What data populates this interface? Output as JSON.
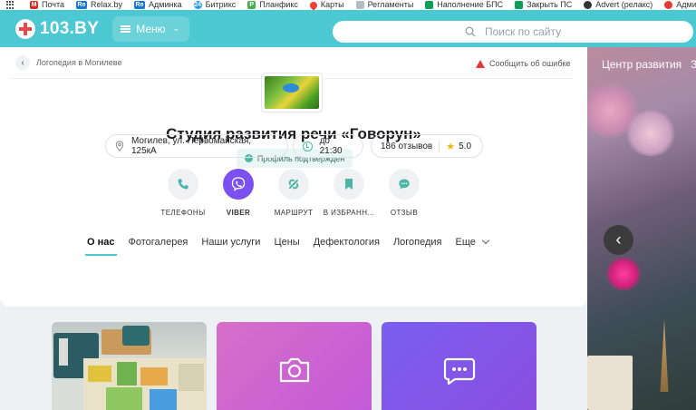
{
  "browser": {
    "bookmarks": [
      {
        "label": "Почта",
        "icon": "gmail-icon",
        "color": "#d93025",
        "glyph": "M"
      },
      {
        "label": "Relax.by",
        "icon": "relax-icon",
        "color": "#1976d2",
        "glyph": "Re"
      },
      {
        "label": "Админка",
        "icon": "relax-admin-icon",
        "color": "#1976d2",
        "glyph": "Re"
      },
      {
        "label": "Битрикс",
        "icon": "bitrix-icon",
        "color": "#2196f3",
        "glyph": "24"
      },
      {
        "label": "Планфикс",
        "icon": "planfix-icon",
        "color": "#4caf50",
        "glyph": "P"
      },
      {
        "label": "Карты",
        "icon": "maps-icon",
        "color": "#ea4335",
        "glyph": "●"
      },
      {
        "label": "Регламенты",
        "icon": "doc-icon",
        "color": "#90a4ae",
        "glyph": "≡"
      },
      {
        "label": "Наполнение БПС",
        "icon": "sheets-icon",
        "color": "#0f9d58",
        "glyph": "▦"
      },
      {
        "label": "Закрыть ПС",
        "icon": "sheets-icon-2",
        "color": "#0f9d58",
        "glyph": "▦"
      },
      {
        "label": "Advert (релакс)",
        "icon": "github-icon",
        "color": "#333333",
        "glyph": "◉"
      },
      {
        "label": "Админ",
        "icon": "admin-icon",
        "color": "#e53935",
        "glyph": "●"
      }
    ]
  },
  "header": {
    "logo": "103.BY",
    "menu_label": "Меню",
    "search_placeholder": "Поиск по сайту",
    "color": "#4bc8d1"
  },
  "breadcrumb": {
    "label": "Логопедия в Могилеве"
  },
  "report": {
    "label": "Сообщить об ошибке"
  },
  "profile": {
    "title": "Студия развития речи «Говорун»",
    "verified": "Профиль подтвержден",
    "address": "Могилев, ул. Первомайская, 125кА",
    "hours": "до 21:30",
    "reviews": "186 отзывов",
    "rating": "5.0"
  },
  "actions": [
    {
      "label": "ТЕЛЕФОНЫ",
      "icon": "phone-icon"
    },
    {
      "label": "VIBER",
      "icon": "viber-icon"
    },
    {
      "label": "МАРШРУТ",
      "icon": "route-icon"
    },
    {
      "label": "В ИЗБРАНН...",
      "icon": "bookmark-icon"
    },
    {
      "label": "ОТЗЫВ",
      "icon": "review-icon"
    }
  ],
  "tabs": [
    "О нас",
    "Фотогалерея",
    "Наши услуги",
    "Цены",
    "Дефектология",
    "Логопедия",
    "Еще"
  ],
  "banner": {
    "items": [
      "Центр развития",
      "За"
    ]
  },
  "tiles": [
    {
      "name": "photo",
      "icon": "classroom-photo"
    },
    {
      "name": "gallery",
      "icon": "camera-icon"
    },
    {
      "name": "reviews",
      "icon": "chat-icon"
    }
  ]
}
